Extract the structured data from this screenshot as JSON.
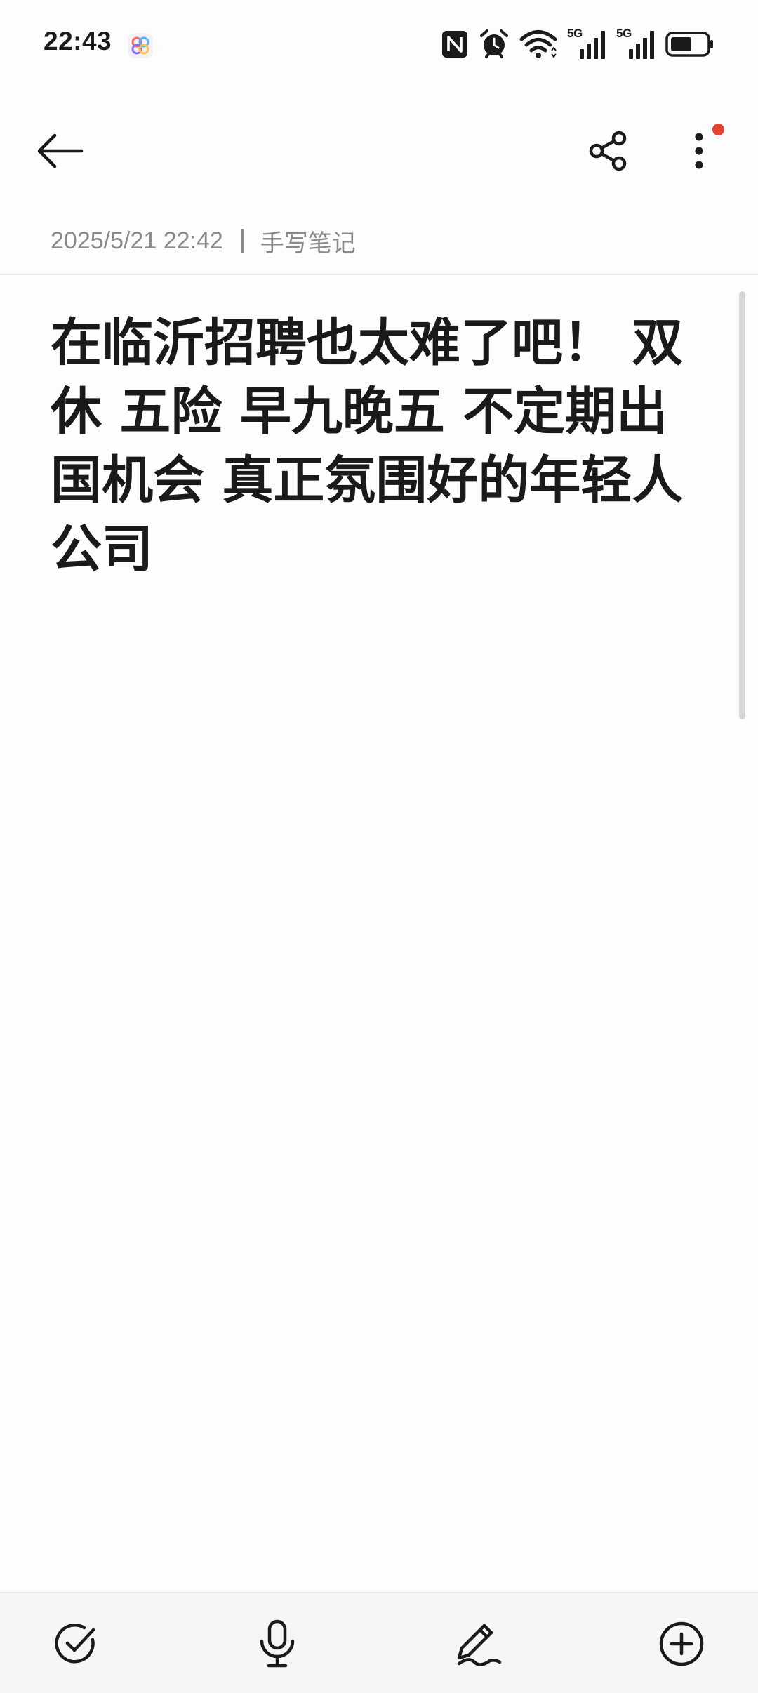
{
  "status_bar": {
    "time": "22:43",
    "network_1": "5G",
    "network_2": "5G",
    "battery_level": 0.6,
    "icons": [
      "app-indicator-icon",
      "nfc-icon",
      "alarm-icon",
      "wifi-icon",
      "signal-icon",
      "signal-icon",
      "battery-icon"
    ]
  },
  "toolbar": {
    "icons": [
      "back-arrow-icon",
      "share-icon",
      "more-vertical-icon"
    ],
    "has_notification_dot": true,
    "notification_color": "#e8412f"
  },
  "note": {
    "datetime": "2025/5/21 22:42",
    "category": "手写笔记",
    "content": "在临沂招聘也太难了吧！ 双休 五险 早九晚五 不定期出国机会  真正氛围好的年轻人公司"
  },
  "bottom_bar": {
    "icons": [
      "checklist-icon",
      "microphone-icon",
      "handwriting-pen-icon",
      "add-circle-icon"
    ]
  },
  "colors": {
    "background": "#fdfdfd",
    "text": "#1a1a1a",
    "meta_text": "#8a8a8a",
    "accent_dot": "#e8412f"
  }
}
